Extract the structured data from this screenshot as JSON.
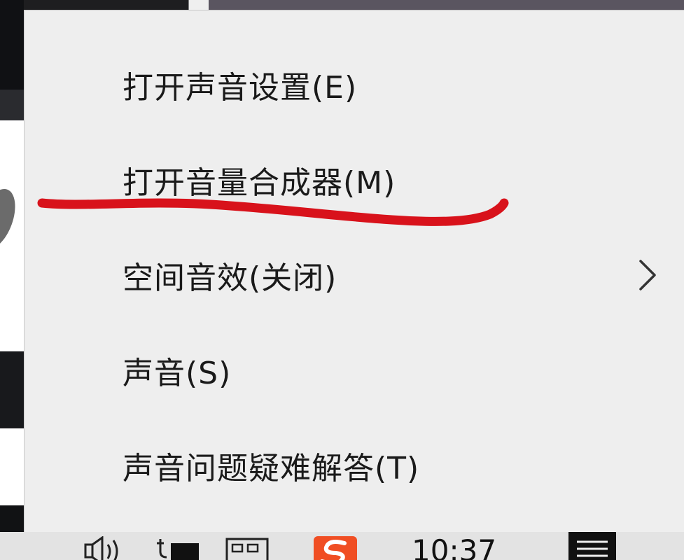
{
  "context_menu": {
    "items": [
      {
        "label": "打开声音设置(E)",
        "has_submenu": false
      },
      {
        "label": "打开音量合成器(M)",
        "has_submenu": false,
        "annotated": true
      },
      {
        "label": "空间音效(关闭)",
        "has_submenu": true
      },
      {
        "label": "声音(S)",
        "has_submenu": false
      },
      {
        "label": "声音问题疑难解答(T)",
        "has_submenu": false
      }
    ],
    "submenu_icon": "chevron-right-icon"
  },
  "annotation": {
    "color": "#d8121b",
    "type": "freehand-underline"
  },
  "taskbar": {
    "clock_time": "10:37",
    "tray_icons": [
      "speaker-icon",
      "battery-plug-icon",
      "ime-keyboard-icon",
      "sogou-input-icon",
      "action-center-icon"
    ]
  },
  "colors": {
    "menu_background": "#eeeeee",
    "menu_text": "#1a1a1a",
    "taskbar_background": "#e3e3e3",
    "sogou_brand": "#f04e23"
  }
}
